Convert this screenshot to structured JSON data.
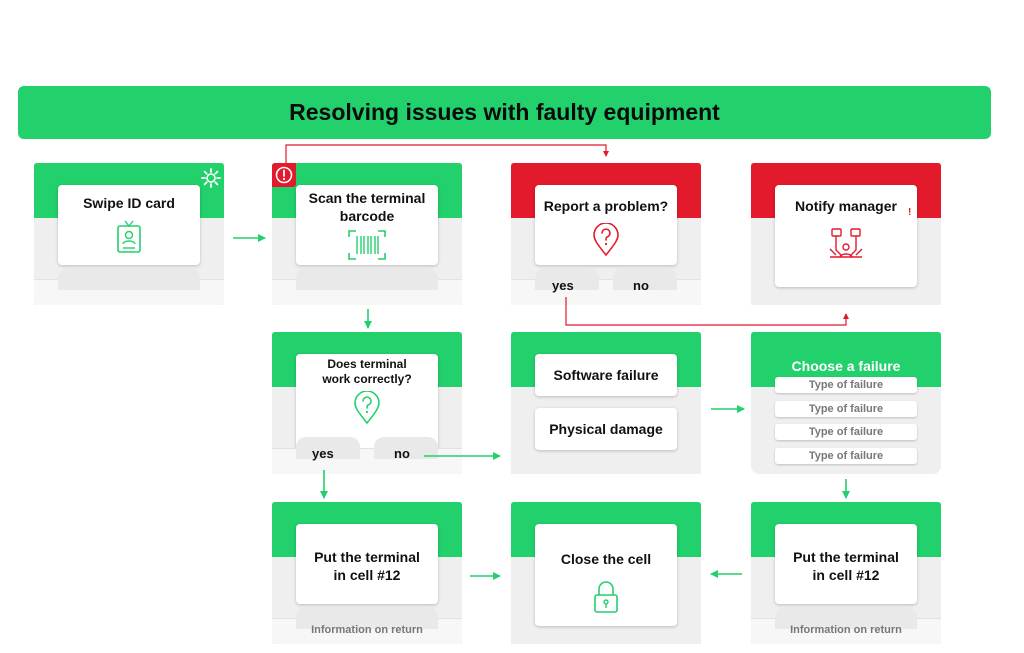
{
  "title": "Resolving issues with faulty equipment",
  "nodes": {
    "swipe": {
      "label": "Swipe ID card",
      "icon": "id-card-icon"
    },
    "scan": {
      "label": "Scan the terminal barcode",
      "icon": "barcode-icon"
    },
    "report": {
      "label": "Report a problem?",
      "yes": "yes",
      "no": "no",
      "icon": "question-pin-icon"
    },
    "notify": {
      "label": "Notify manager",
      "icon": "manager-network-icon"
    },
    "works": {
      "label": "Does terminal work correctly?",
      "yes": "yes",
      "no": "no",
      "icon": "question-pin-icon"
    },
    "failure_kind": {
      "options": [
        "Software failure",
        "Physical damage"
      ]
    },
    "choose": {
      "title": "Choose a failure",
      "items": [
        "Type of failure",
        "Type of failure",
        "Type of failure",
        "Type of failure"
      ]
    },
    "put_left": {
      "label": "Put the terminal in cell #12",
      "footer": "Information on return"
    },
    "close": {
      "label": "Close the cell",
      "icon": "padlock-icon"
    },
    "put_right": {
      "label": "Put the terminal in cell #12",
      "footer": "Information on return"
    }
  },
  "colors": {
    "green": "#22d06c",
    "red": "#e3192c",
    "panel": "#efefef"
  }
}
